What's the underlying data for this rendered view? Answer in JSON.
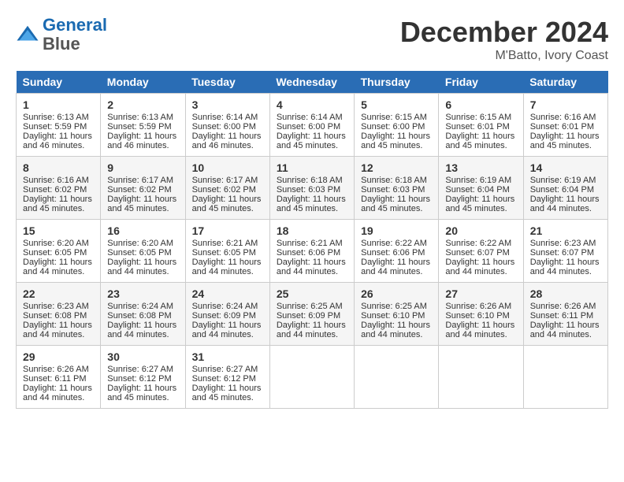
{
  "header": {
    "logo_line1": "General",
    "logo_line2": "Blue",
    "month_title": "December 2024",
    "location": "M'Batto, Ivory Coast"
  },
  "days_of_week": [
    "Sunday",
    "Monday",
    "Tuesday",
    "Wednesday",
    "Thursday",
    "Friday",
    "Saturday"
  ],
  "weeks": [
    [
      {
        "day": "1",
        "sunrise": "6:13 AM",
        "sunset": "5:59 PM",
        "daylight": "11 hours and 46 minutes."
      },
      {
        "day": "2",
        "sunrise": "6:13 AM",
        "sunset": "5:59 PM",
        "daylight": "11 hours and 46 minutes."
      },
      {
        "day": "3",
        "sunrise": "6:14 AM",
        "sunset": "6:00 PM",
        "daylight": "11 hours and 46 minutes."
      },
      {
        "day": "4",
        "sunrise": "6:14 AM",
        "sunset": "6:00 PM",
        "daylight": "11 hours and 45 minutes."
      },
      {
        "day": "5",
        "sunrise": "6:15 AM",
        "sunset": "6:00 PM",
        "daylight": "11 hours and 45 minutes."
      },
      {
        "day": "6",
        "sunrise": "6:15 AM",
        "sunset": "6:01 PM",
        "daylight": "11 hours and 45 minutes."
      },
      {
        "day": "7",
        "sunrise": "6:16 AM",
        "sunset": "6:01 PM",
        "daylight": "11 hours and 45 minutes."
      }
    ],
    [
      {
        "day": "8",
        "sunrise": "6:16 AM",
        "sunset": "6:02 PM",
        "daylight": "11 hours and 45 minutes."
      },
      {
        "day": "9",
        "sunrise": "6:17 AM",
        "sunset": "6:02 PM",
        "daylight": "11 hours and 45 minutes."
      },
      {
        "day": "10",
        "sunrise": "6:17 AM",
        "sunset": "6:02 PM",
        "daylight": "11 hours and 45 minutes."
      },
      {
        "day": "11",
        "sunrise": "6:18 AM",
        "sunset": "6:03 PM",
        "daylight": "11 hours and 45 minutes."
      },
      {
        "day": "12",
        "sunrise": "6:18 AM",
        "sunset": "6:03 PM",
        "daylight": "11 hours and 45 minutes."
      },
      {
        "day": "13",
        "sunrise": "6:19 AM",
        "sunset": "6:04 PM",
        "daylight": "11 hours and 45 minutes."
      },
      {
        "day": "14",
        "sunrise": "6:19 AM",
        "sunset": "6:04 PM",
        "daylight": "11 hours and 44 minutes."
      }
    ],
    [
      {
        "day": "15",
        "sunrise": "6:20 AM",
        "sunset": "6:05 PM",
        "daylight": "11 hours and 44 minutes."
      },
      {
        "day": "16",
        "sunrise": "6:20 AM",
        "sunset": "6:05 PM",
        "daylight": "11 hours and 44 minutes."
      },
      {
        "day": "17",
        "sunrise": "6:21 AM",
        "sunset": "6:05 PM",
        "daylight": "11 hours and 44 minutes."
      },
      {
        "day": "18",
        "sunrise": "6:21 AM",
        "sunset": "6:06 PM",
        "daylight": "11 hours and 44 minutes."
      },
      {
        "day": "19",
        "sunrise": "6:22 AM",
        "sunset": "6:06 PM",
        "daylight": "11 hours and 44 minutes."
      },
      {
        "day": "20",
        "sunrise": "6:22 AM",
        "sunset": "6:07 PM",
        "daylight": "11 hours and 44 minutes."
      },
      {
        "day": "21",
        "sunrise": "6:23 AM",
        "sunset": "6:07 PM",
        "daylight": "11 hours and 44 minutes."
      }
    ],
    [
      {
        "day": "22",
        "sunrise": "6:23 AM",
        "sunset": "6:08 PM",
        "daylight": "11 hours and 44 minutes."
      },
      {
        "day": "23",
        "sunrise": "6:24 AM",
        "sunset": "6:08 PM",
        "daylight": "11 hours and 44 minutes."
      },
      {
        "day": "24",
        "sunrise": "6:24 AM",
        "sunset": "6:09 PM",
        "daylight": "11 hours and 44 minutes."
      },
      {
        "day": "25",
        "sunrise": "6:25 AM",
        "sunset": "6:09 PM",
        "daylight": "11 hours and 44 minutes."
      },
      {
        "day": "26",
        "sunrise": "6:25 AM",
        "sunset": "6:10 PM",
        "daylight": "11 hours and 44 minutes."
      },
      {
        "day": "27",
        "sunrise": "6:26 AM",
        "sunset": "6:10 PM",
        "daylight": "11 hours and 44 minutes."
      },
      {
        "day": "28",
        "sunrise": "6:26 AM",
        "sunset": "6:11 PM",
        "daylight": "11 hours and 44 minutes."
      }
    ],
    [
      {
        "day": "29",
        "sunrise": "6:26 AM",
        "sunset": "6:11 PM",
        "daylight": "11 hours and 44 minutes."
      },
      {
        "day": "30",
        "sunrise": "6:27 AM",
        "sunset": "6:12 PM",
        "daylight": "11 hours and 45 minutes."
      },
      {
        "day": "31",
        "sunrise": "6:27 AM",
        "sunset": "6:12 PM",
        "daylight": "11 hours and 45 minutes."
      },
      null,
      null,
      null,
      null
    ]
  ]
}
